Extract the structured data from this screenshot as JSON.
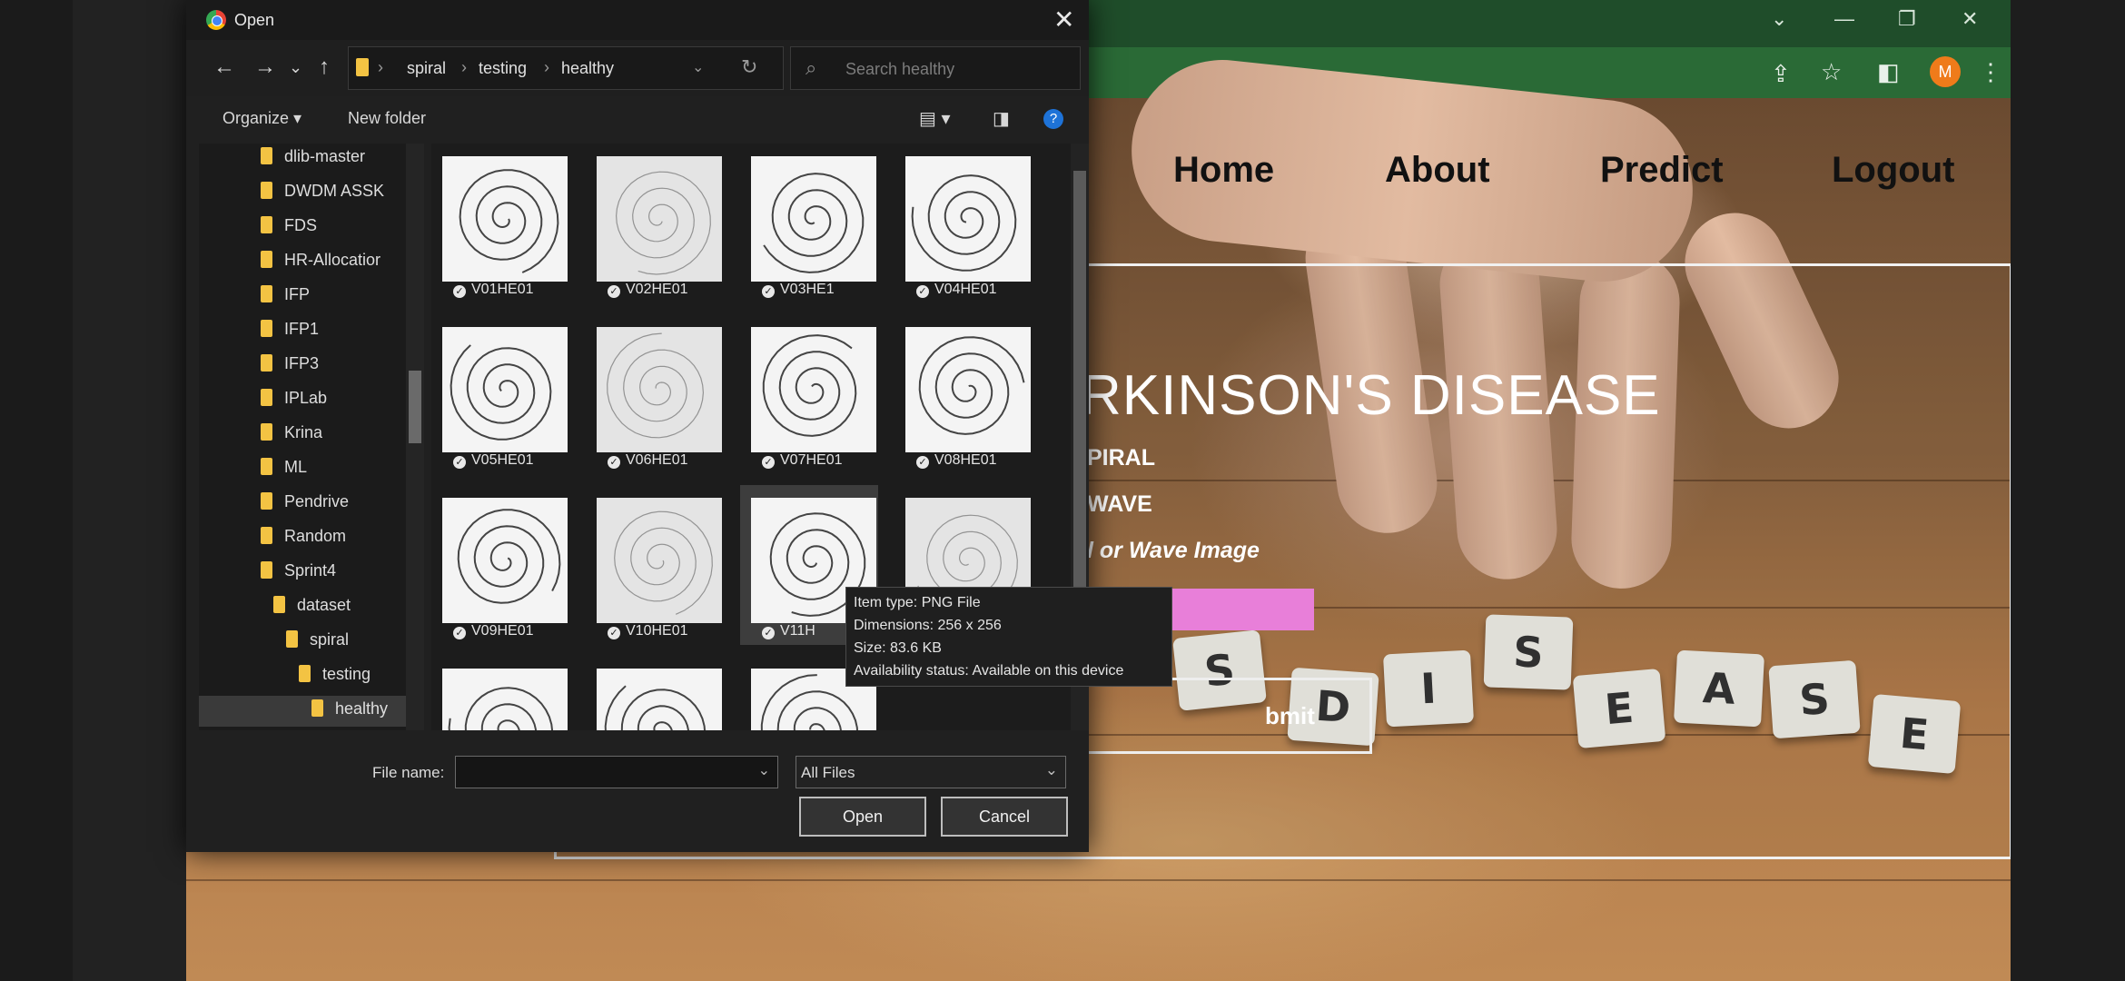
{
  "browser": {
    "window_controls": [
      "⌄",
      "—",
      "❐",
      "✕"
    ],
    "toolbar_icons": [
      "share-icon",
      "star-icon",
      "sidebar-icon",
      "menu-icon"
    ],
    "avatar_letter": "M",
    "avatar_color": "#ef7b1a"
  },
  "website": {
    "nav": [
      "Home",
      "About",
      "Predict",
      "Logout"
    ],
    "heading": "RKINSON'S DISEASE",
    "option1": "PIRAL",
    "option2": "WAVE",
    "prompt": "l or Wave Image",
    "submit": "bmit",
    "accent": "#e87fd9",
    "tiles": [
      "S",
      "D",
      "I",
      "S",
      "E",
      "A",
      "S",
      "E"
    ]
  },
  "dialog": {
    "title": "Open",
    "close": "✕",
    "nav_buttons": [
      "←",
      "→",
      "⌄",
      "↑"
    ],
    "breadcrumb": [
      "spiral",
      "testing",
      "healthy"
    ],
    "refresh": "↻",
    "search_placeholder": "Search healthy",
    "organize": "Organize ▾",
    "new_folder": "New folder",
    "help": "?",
    "tree": [
      {
        "label": "dlib-master"
      },
      {
        "label": "DWDM ASSK"
      },
      {
        "label": "FDS"
      },
      {
        "label": "HR-Allocatior"
      },
      {
        "label": "IFP"
      },
      {
        "label": "IFP1"
      },
      {
        "label": "IFP3"
      },
      {
        "label": "IPLab"
      },
      {
        "label": "Krina"
      },
      {
        "label": "ML"
      },
      {
        "label": "Pendrive"
      },
      {
        "label": "Random"
      },
      {
        "label": "Sprint4"
      },
      {
        "label": "dataset"
      },
      {
        "label": "spiral"
      },
      {
        "label": "testing"
      },
      {
        "label": "healthy"
      }
    ],
    "files": [
      "V01HE01",
      "V02HE01",
      "V03HE1",
      "V04HE01",
      "V05HE01",
      "V06HE01",
      "V07HE01",
      "V08HE01",
      "V09HE01",
      "V10HE01",
      "V11H",
      "",
      "",
      "",
      ""
    ],
    "tooltip": {
      "type": "Item type: PNG File",
      "dimensions": "Dimensions: 256 x 256",
      "size": "Size: 83.6 KB",
      "availability": "Availability status: Available on this device"
    },
    "file_name_label": "File name:",
    "file_name_value": "",
    "filter": "All Files",
    "open": "Open",
    "cancel": "Cancel"
  }
}
